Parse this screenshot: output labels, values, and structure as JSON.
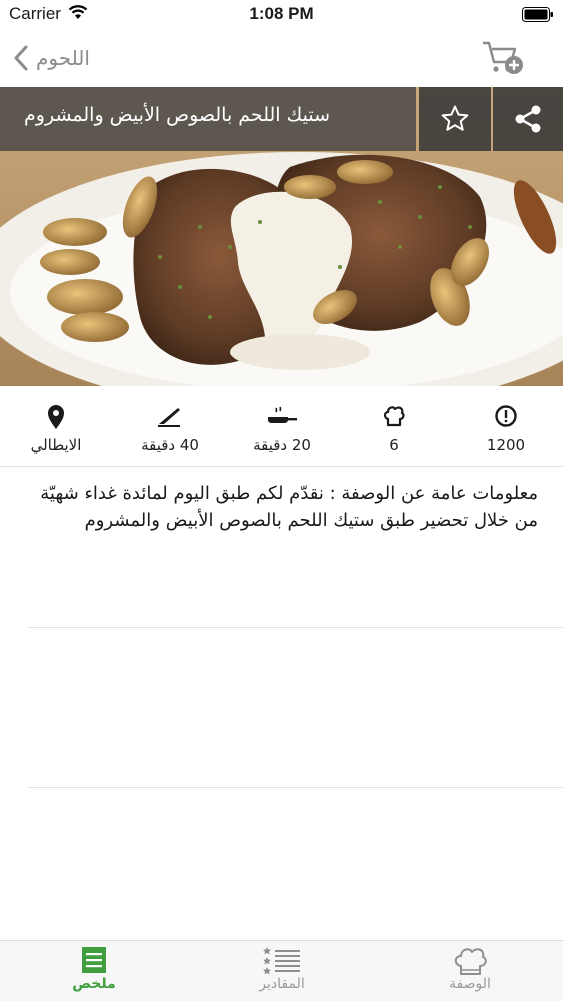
{
  "status_bar": {
    "carrier": "Carrier",
    "time": "1:08 PM"
  },
  "nav": {
    "back_label": "اللحوم"
  },
  "recipe": {
    "title": "ستيك اللحم بالصوص الأبيض والمشروم",
    "stats": [
      {
        "icon": "info-icon",
        "value": "1200"
      },
      {
        "icon": "chef-hat-icon",
        "value": "6"
      },
      {
        "icon": "pan-icon",
        "value": "20 دقيقة"
      },
      {
        "icon": "knife-icon",
        "value": "40 دقيقة"
      },
      {
        "icon": "location-pin-icon",
        "value": "الايطالي"
      }
    ],
    "info": "معلومات عامة عن الوصفة : نقدّم لكم طبق اليوم لمائدة غداء شهيّة من خلال تحضير طبق ستيك اللحم بالصوص الأبيض والمشروم"
  },
  "tabs": [
    {
      "label": "ملخص",
      "icon": "summary-list-icon",
      "active": true
    },
    {
      "label": "المقادير",
      "icon": "ingredients-list-icon",
      "active": false
    },
    {
      "label": "الوصفة",
      "icon": "chef-hat-icon",
      "active": false
    }
  ],
  "colors": {
    "accent": "#3f9f3f",
    "overlay": "#464646"
  }
}
